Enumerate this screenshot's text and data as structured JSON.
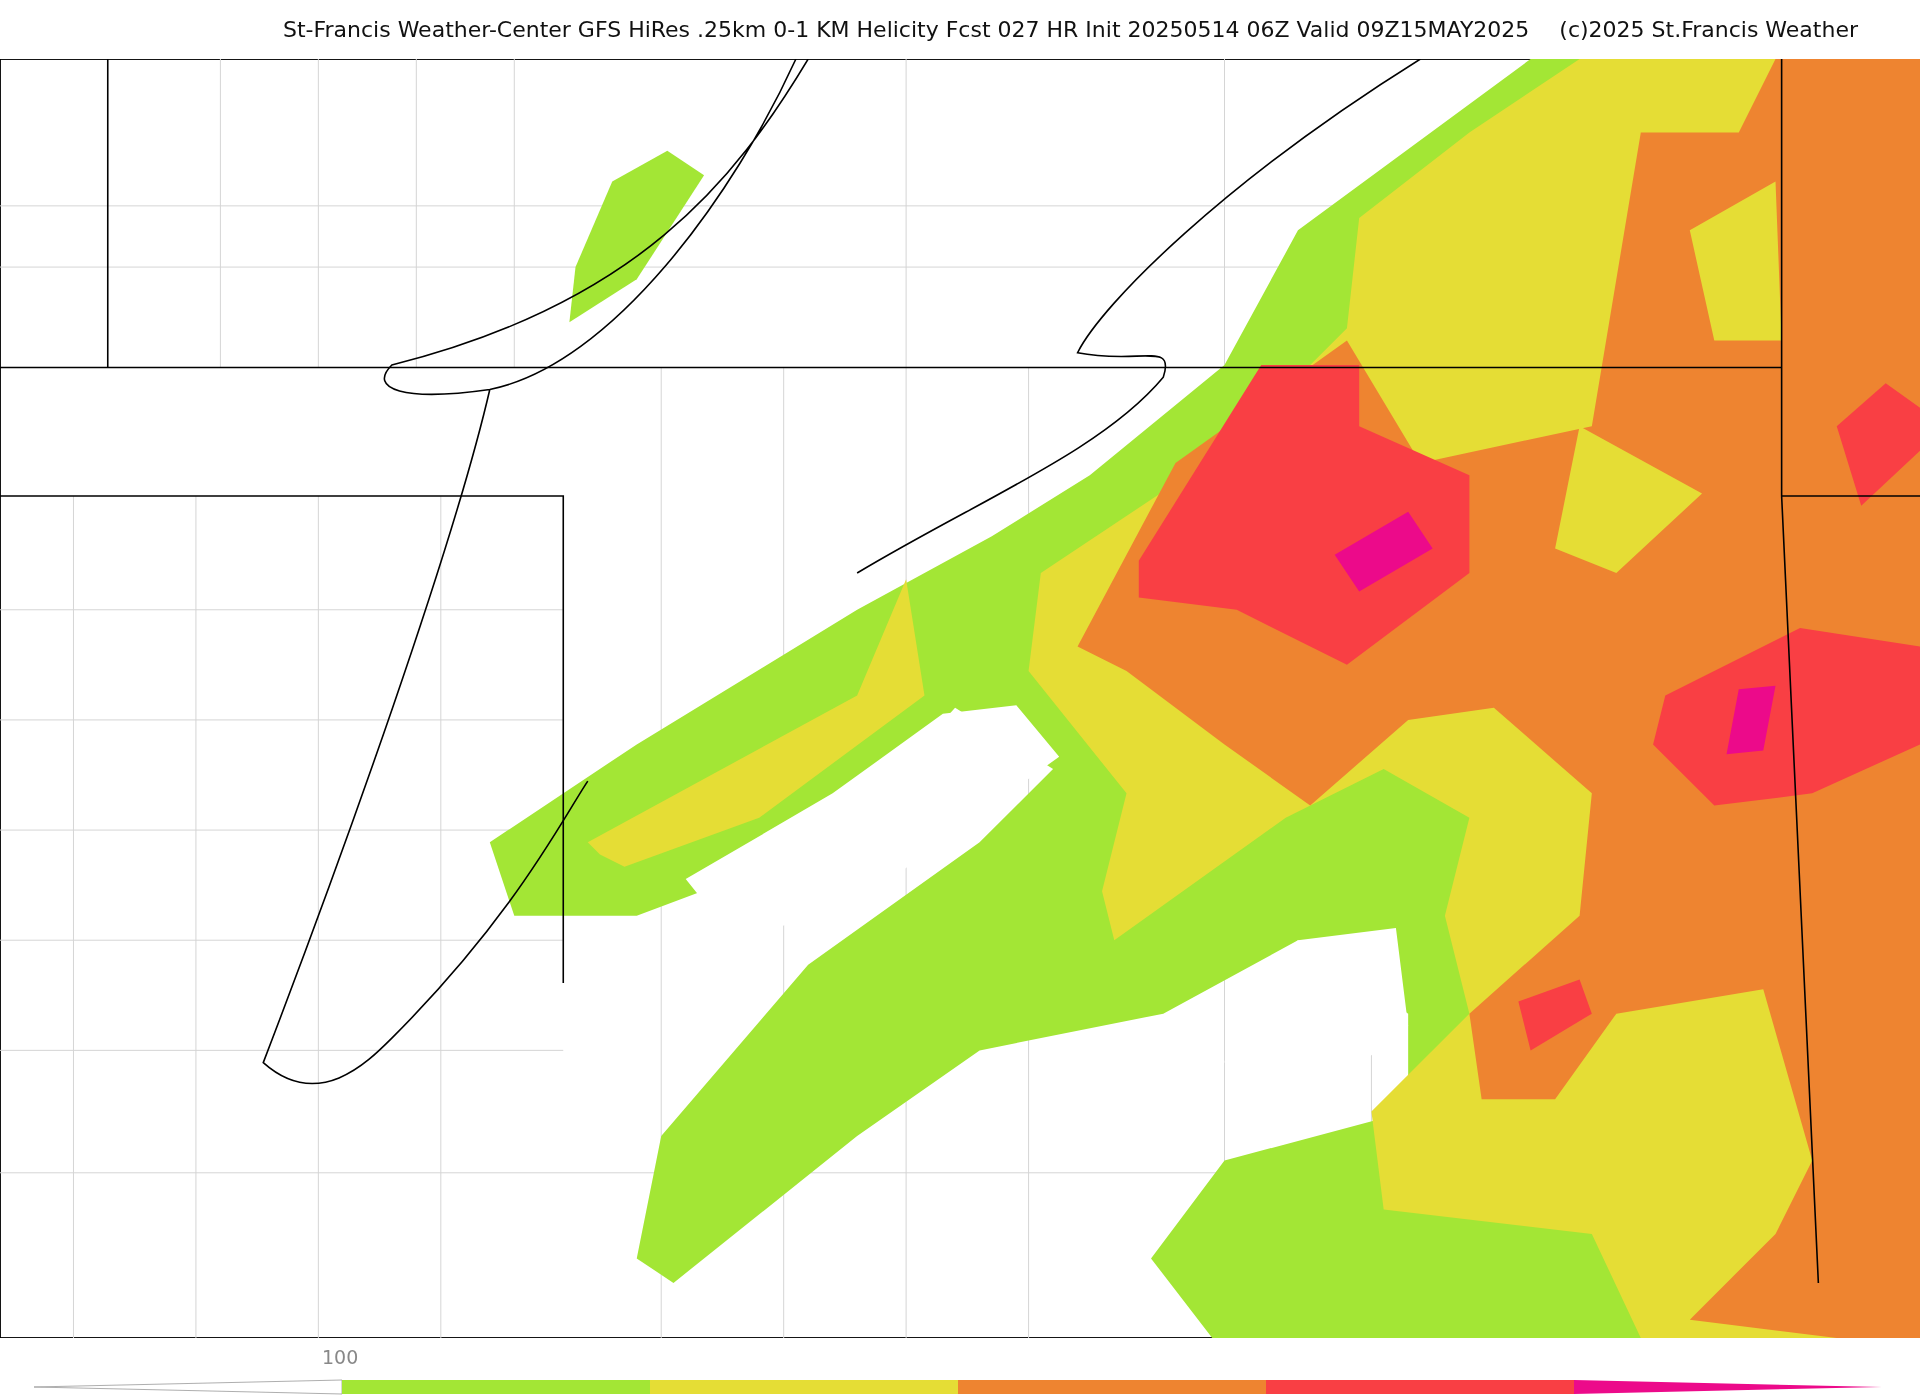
{
  "title": {
    "text": "St-Francis Weather-Center GFS HiRes .25km 0-1 KM Helicity Fcst 027 HR Init 20250514 06Z  Valid 09Z15MAY2025",
    "copyright": "(c)2025 St.Francis Weather"
  },
  "colorbar": {
    "tick_label": "100",
    "segments": [
      {
        "kind": "low_end",
        "color": "#ffffff"
      },
      {
        "kind": "band",
        "color": "#a3e635"
      },
      {
        "kind": "band",
        "color": "#e5dd35"
      },
      {
        "kind": "band",
        "color": "#ee8430"
      },
      {
        "kind": "band",
        "color": "#f93f44"
      },
      {
        "kind": "high_end",
        "color": "#ec0a8a"
      }
    ]
  }
}
